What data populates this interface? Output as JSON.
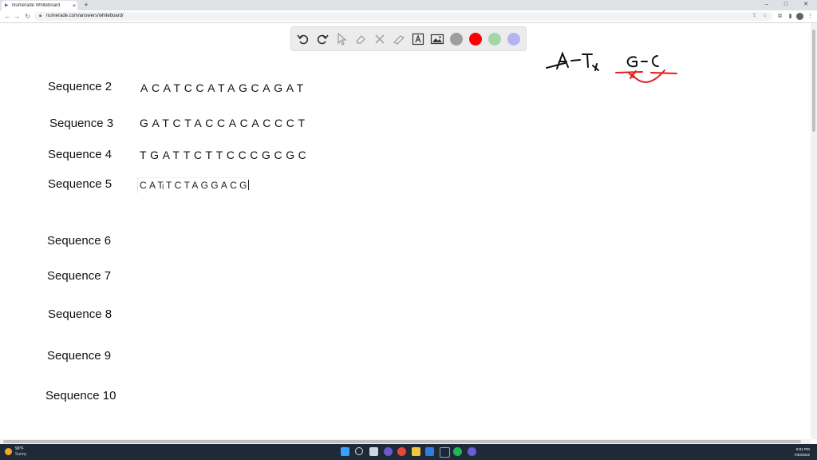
{
  "browser": {
    "tab_title": "Numerade Whiteboard",
    "url": "numerade.com/answers/whiteboard/",
    "window_controls": [
      "–",
      "□",
      "✕"
    ]
  },
  "whiteboard_toolbar": {
    "tools": [
      "undo-icon",
      "redo-icon",
      "select-icon",
      "eraser-icon",
      "clear-icon",
      "highlighter-icon",
      "text-icon",
      "image-icon"
    ],
    "colors": [
      "#9e9e9e",
      "#ff0000",
      "#a5d6a7",
      "#b4b4f0"
    ]
  },
  "sequences": [
    {
      "label": "Sequence 2",
      "value": "ACATCCATAGCAGAT"
    },
    {
      "label": "Sequence 3",
      "value": "GATCTACCACACCCT"
    },
    {
      "label": "Sequence 4",
      "value": "TGATTCTTCCCGCGC"
    },
    {
      "label": "Sequence 5",
      "value": "CATTCTAGGACG"
    },
    {
      "label": "Sequence 6",
      "value": ""
    },
    {
      "label": "Sequence 7",
      "value": ""
    },
    {
      "label": "Sequence 8",
      "value": ""
    },
    {
      "label": "Sequence 9",
      "value": ""
    },
    {
      "label": "Sequence 10",
      "value": ""
    }
  ],
  "handwriting": {
    "pair_1": "A-T",
    "pair_2": "G-C"
  },
  "taskbar": {
    "weather_temp": "96°F",
    "weather_condition": "Sunny",
    "time": "8:01 PM",
    "date": "7/30/2022"
  }
}
